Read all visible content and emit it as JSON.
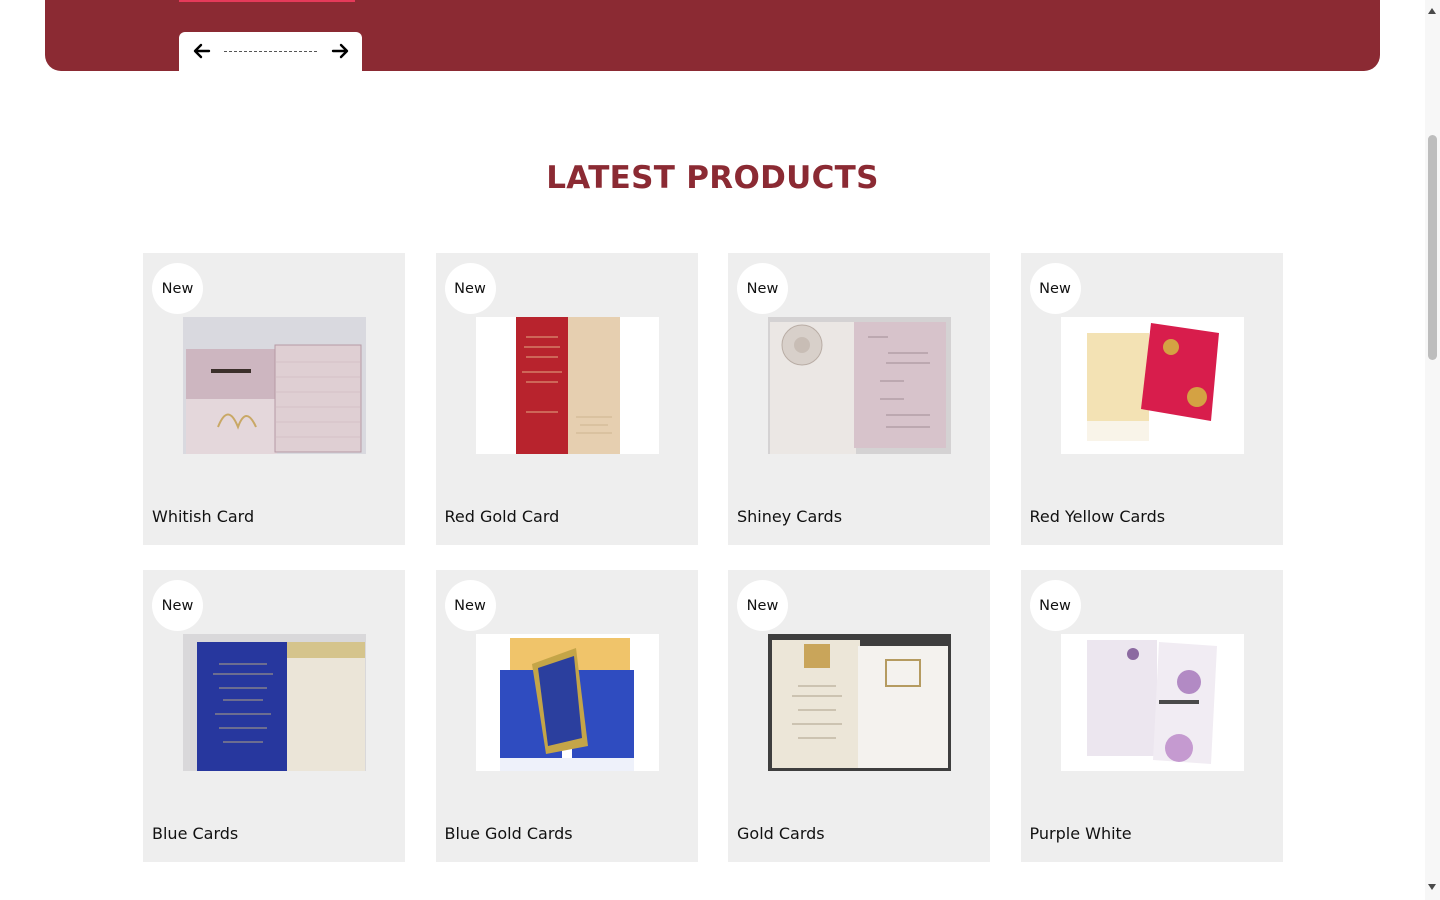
{
  "hero": {
    "colors": {
      "banner": "#8b2a33",
      "accent": "#e63a5a"
    },
    "slider": {
      "prev_icon": "arrow-left-icon",
      "next_icon": "arrow-right-icon"
    }
  },
  "section": {
    "title": "LATEST PRODUCTS",
    "title_color": "#8b2a33"
  },
  "products": [
    {
      "badge": "New",
      "name": "Whitish Card",
      "image": "whitish-card-thumbnail"
    },
    {
      "badge": "New",
      "name": "Red Gold Card",
      "image": "red-gold-card-thumbnail"
    },
    {
      "badge": "New",
      "name": "Shiney Cards",
      "image": "shiney-cards-thumbnail"
    },
    {
      "badge": "New",
      "name": "Red Yellow Cards",
      "image": "red-yellow-cards-thumbnail"
    },
    {
      "badge": "New",
      "name": "Blue Cards",
      "image": "blue-cards-thumbnail"
    },
    {
      "badge": "New",
      "name": "Blue Gold Cards",
      "image": "blue-gold-cards-thumbnail"
    },
    {
      "badge": "New",
      "name": "Gold Cards",
      "image": "gold-cards-thumbnail"
    },
    {
      "badge": "New",
      "name": "Purple White",
      "image": "purple-white-thumbnail"
    }
  ],
  "scrollbar": {
    "up_icon": "scroll-up-arrow-icon",
    "down_icon": "scroll-down-arrow-icon"
  }
}
